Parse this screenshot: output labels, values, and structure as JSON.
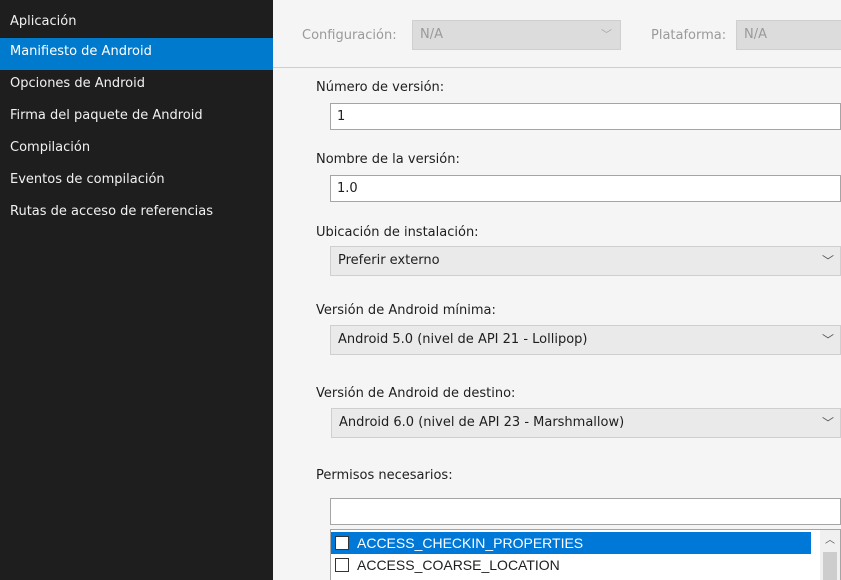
{
  "sidebar": {
    "items": [
      {
        "label": "Aplicación"
      },
      {
        "label": "Manifiesto de Android"
      },
      {
        "label": "Opciones de Android"
      },
      {
        "label": "Firma del paquete de Android"
      },
      {
        "label": "Compilación"
      },
      {
        "label": "Eventos de compilación"
      },
      {
        "label": "Rutas de acceso de referencias"
      }
    ],
    "selected": "Manifiesto de Android"
  },
  "config_bar": {
    "configuration_label": "Configuración:",
    "configuration_value": "N/A",
    "platform_label": "Plataforma:",
    "platform_value": "N/A"
  },
  "form": {
    "version_number_label": "Número de versión:",
    "version_number_value": "1",
    "version_name_label": "Nombre de la versión:",
    "version_name_value": "1.0",
    "install_location_label": "Ubicación de instalación:",
    "install_location_value": "Preferir externo",
    "min_android_label": "Versión de Android mínima:",
    "min_android_value": "Android 5.0 (nivel de API 21 - Lollipop)",
    "target_android_label": "Versión de Android de destino:",
    "target_android_value": "Android 6.0 (nivel de API 23 - Marshmallow)",
    "permissions_label": "Permisos necesarios:",
    "permissions_filter_value": ""
  },
  "permissions": [
    {
      "name": "ACCESS_CHECKIN_PROPERTIES",
      "checked": false,
      "selected": true
    },
    {
      "name": "ACCESS_COARSE_LOCATION",
      "checked": false,
      "selected": false
    }
  ],
  "icons": {
    "dropdown": "chevron-down-icon",
    "scroll_up": "chevron-up-icon"
  },
  "colors": {
    "sidebar_bg": "#1e1e1e",
    "accent": "#007acc",
    "list_selection": "#0078d7",
    "panel_bg": "#f5f5f5"
  }
}
